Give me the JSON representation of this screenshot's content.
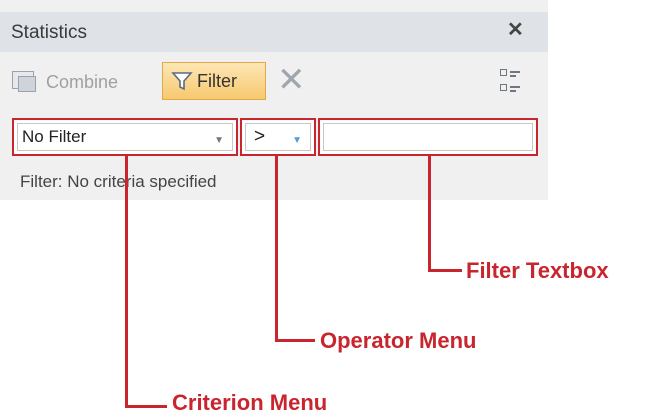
{
  "panel": {
    "title": "Statistics",
    "close_icon": "close-icon"
  },
  "toolbar": {
    "combine_label": "Combine",
    "filter_label": "Filter",
    "clear_icon": "clear-filter-icon",
    "view_icon": "view-options-icon"
  },
  "filter_row": {
    "criterion_value": "No Filter",
    "operator_value": ">",
    "text_value": ""
  },
  "status_text": "Filter: No criteria specified",
  "callouts": {
    "criterion": "Criterion Menu",
    "operator": "Operator Menu",
    "textbox": "Filter Textbox"
  },
  "colors": {
    "accent": "#c9252f",
    "filter_active_bg": "#f7c96f",
    "panel_bg": "#f0f0f0",
    "titlebar_bg": "#dfe3e8"
  }
}
